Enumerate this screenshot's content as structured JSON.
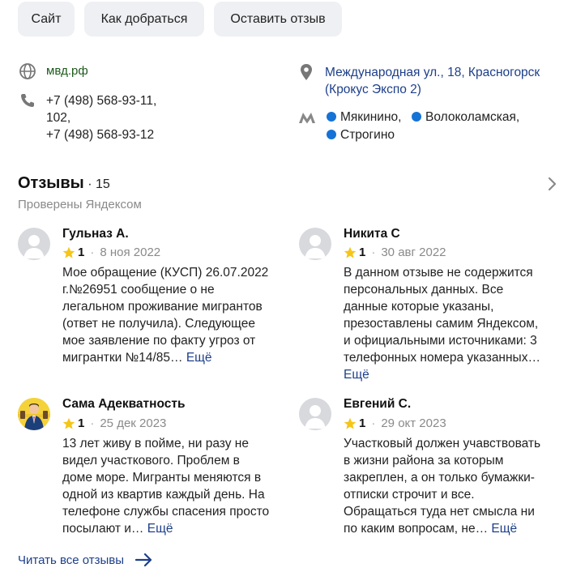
{
  "actions": {
    "site_label": "Сайт",
    "route_label": "Как добраться",
    "review_label": "Оставить отзыв"
  },
  "contacts": {
    "website": "мвд.рф",
    "phone_line1": "+7 (498) 568-93-11,",
    "phone_line2": "102,",
    "phone_line3": "+7 (498) 568-93-12",
    "address_line1": "Международная ул., 18, Красногорск",
    "address_line2": "(Крокус Экспо 2)",
    "metro": [
      "Мякинино,",
      "Волоколамская,",
      "Строгино"
    ],
    "metro_color": "#1572d6"
  },
  "reviews_header": {
    "title": "Отзывы",
    "count": "· 15",
    "subtitle": "Проверены Яндексом"
  },
  "reviews": [
    {
      "name": "Гульназ А.",
      "rating": "1",
      "date": "8 ноя 2022",
      "lines": [
        "Мое обращение (КУСП) 26.07.2022",
        "г.№26951 сообщение о не",
        "легальном проживание мигрантов",
        "(ответ не получила). Следующее",
        "мое заявление по факту угроз от",
        "мигрантки №14/85…"
      ],
      "more": "Ещё"
    },
    {
      "name": "Никита С",
      "rating": "1",
      "date": "30 авг 2022",
      "lines": [
        "В данном отзыве не содержится",
        "персональных данных. Все",
        "данные которые указаны,",
        "презоставлены самим Яндексом,",
        "и официальными источниками: 3",
        "телефонных номера указанных…"
      ],
      "more": "Ещё"
    },
    {
      "name": "Сама Адекватность",
      "rating": "1",
      "date": "25 дек 2023",
      "lines": [
        "13 лет живу в пойме, ни разу не",
        "видел участкового. Проблем в",
        "доме море. Мигранты меняются в",
        "одной из квартив каждый день. На",
        "телефоне службы спасения просто",
        "посылают и…"
      ],
      "more": "Ещё"
    },
    {
      "name": "Евгений С.",
      "rating": "1",
      "date": "29 окт 2023",
      "lines": [
        "Участковый должен учавствовать",
        "в жизни района за которым",
        "закреплен, а он только бумажки-",
        "отписки строчит и все.",
        "Обращаться туда нет смысла ни",
        "по каким вопросам, не…"
      ],
      "more": "Ещё"
    }
  ],
  "read_all": "Читать все отзывы",
  "colors": {
    "star": "#f5c518",
    "link": "#1d3f8a",
    "website": "#1c5a1c",
    "button_bg": "#eef0f3"
  }
}
